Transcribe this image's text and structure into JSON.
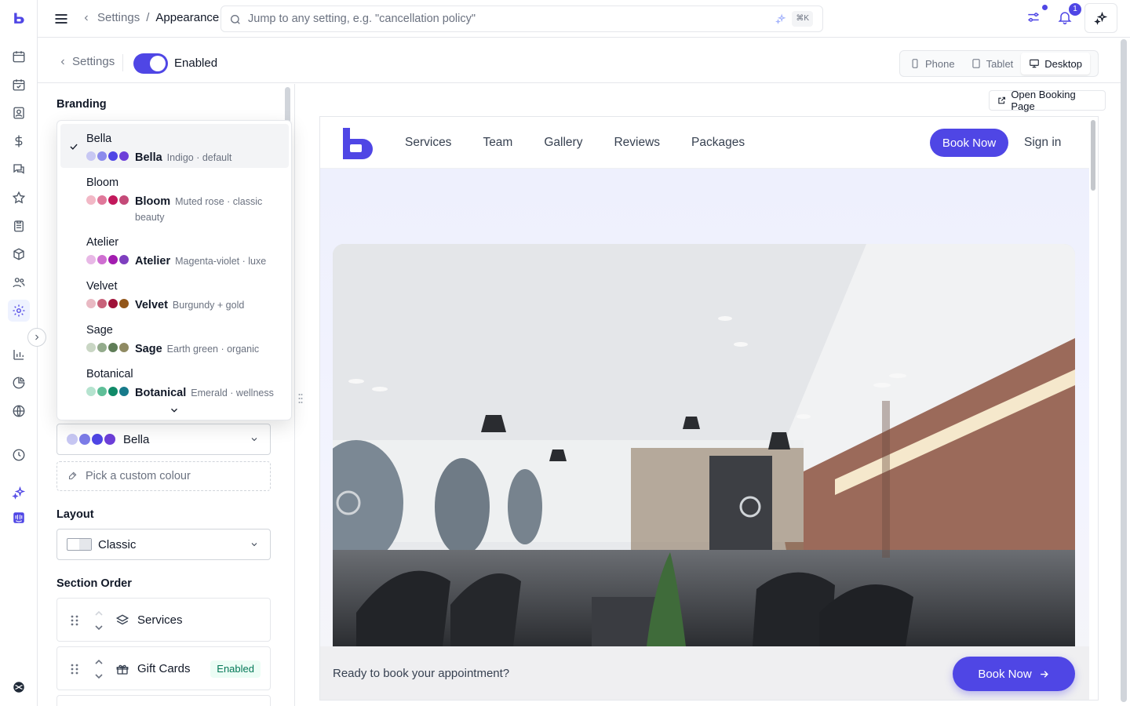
{
  "topbar": {
    "breadcrumb_parent": "Settings",
    "breadcrumb_separator": "/",
    "breadcrumb_current": "Appearance",
    "search_placeholder": "Jump to any setting, e.g. \"cancellation policy\"",
    "search_shortcut": "⌘K",
    "notification_count": "1"
  },
  "subheader": {
    "back_label": "Settings",
    "toggle_label": "Enabled",
    "toggle_on": true,
    "devices": [
      "Phone",
      "Tablet",
      "Desktop"
    ],
    "active_device": "Desktop"
  },
  "panel": {
    "branding_title": "Branding",
    "theme_selected": "Bella",
    "theme_swatches": [
      "#c7c7f3",
      "#7c7ce8",
      "#4f46e5",
      "#6d3fd9"
    ],
    "custom_colour_placeholder": "Pick a custom colour",
    "layout_title": "Layout",
    "layout_value": "Classic",
    "section_order_title": "Section Order",
    "sections": [
      {
        "label": "Services",
        "icon": "layers-icon",
        "badge": ""
      },
      {
        "label": "Gift Cards",
        "icon": "gift-icon",
        "badge": "Enabled"
      }
    ]
  },
  "dropdown": {
    "options": [
      {
        "name": "Bella",
        "title": "Bella",
        "desc": "Indigo · default",
        "selected": true,
        "colors": [
          "#c7c7f3",
          "#8b8bec",
          "#4f46e5",
          "#6d3fd9"
        ]
      },
      {
        "name": "Bloom",
        "title": "Bloom",
        "desc": "Muted rose · classic beauty",
        "selected": false,
        "colors": [
          "#f2b8c6",
          "#e0789a",
          "#c2185b",
          "#c44a78"
        ]
      },
      {
        "name": "Atelier",
        "title": "Atelier",
        "desc": "Magenta-violet · luxe",
        "selected": false,
        "colors": [
          "#e8b8e6",
          "#cf6fd1",
          "#a21caf",
          "#7e3fbf"
        ]
      },
      {
        "name": "Velvet",
        "title": "Velvet",
        "desc": "Burgundy + gold",
        "selected": false,
        "colors": [
          "#e9b9c3",
          "#c8627a",
          "#9f1239",
          "#92561a"
        ]
      },
      {
        "name": "Sage",
        "title": "Sage",
        "desc": "Earth green · organic",
        "selected": false,
        "colors": [
          "#c9d6c4",
          "#93ab8c",
          "#5f7d57",
          "#8f8a62"
        ]
      },
      {
        "name": "Botanical",
        "title": "Botanical",
        "desc": "Emerald · wellness",
        "selected": false,
        "colors": [
          "#b5e3cf",
          "#5fbf98",
          "#108a68",
          "#177a8a"
        ]
      }
    ]
  },
  "preview": {
    "open_label": "Open Booking Page",
    "nav_links": [
      "Services",
      "Team",
      "Gallery",
      "Reviews",
      "Packages"
    ],
    "book_label": "Book Now",
    "signin_label": "Sign in",
    "cta_text": "Ready to book your appointment?",
    "cta_button": "Book Now"
  },
  "colors": {
    "accent": "#4f46e5",
    "border": "#e5e7eb",
    "badge_green_bg": "#ecfdf5",
    "badge_green_text": "#047857"
  }
}
